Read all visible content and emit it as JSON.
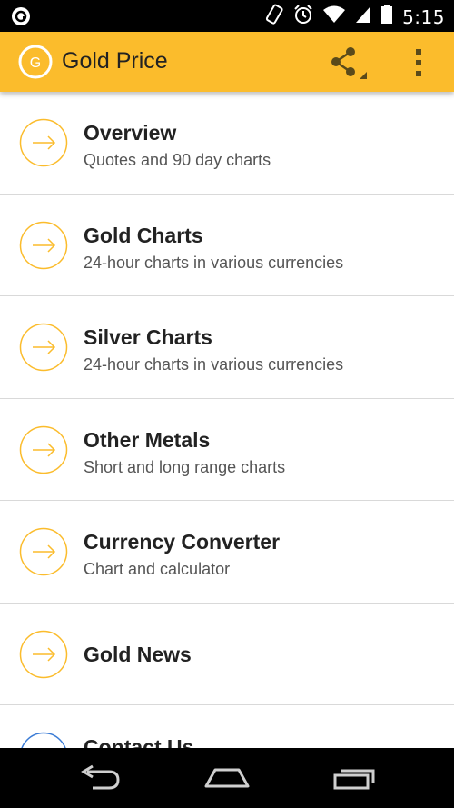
{
  "status_bar": {
    "time": "5:15",
    "icons": [
      "app-notification-icon",
      "vibrate-icon",
      "alarm-icon",
      "wifi-icon",
      "cell-signal-icon",
      "battery-icon"
    ]
  },
  "app_bar": {
    "logo_letter": "G",
    "title": "Gold Price",
    "actions": [
      "share-icon",
      "overflow-menu-icon"
    ],
    "color": "#fbbc2c"
  },
  "menu": {
    "accent": "#fbbc2c",
    "items": [
      {
        "title": "Overview",
        "subtitle": "Quotes and 90 day charts"
      },
      {
        "title": "Gold Charts",
        "subtitle": "24-hour charts in various currencies"
      },
      {
        "title": "Silver Charts",
        "subtitle": "24-hour charts in various currencies"
      },
      {
        "title": "Other Metals",
        "subtitle": "Short and long range charts"
      },
      {
        "title": "Currency Converter",
        "subtitle": "Chart and calculator"
      },
      {
        "title": "Gold News",
        "subtitle": ""
      },
      {
        "title": "Contact Us",
        "subtitle": ""
      }
    ]
  },
  "nav_bar": {
    "buttons": [
      "back-icon",
      "home-icon",
      "recents-icon"
    ]
  }
}
